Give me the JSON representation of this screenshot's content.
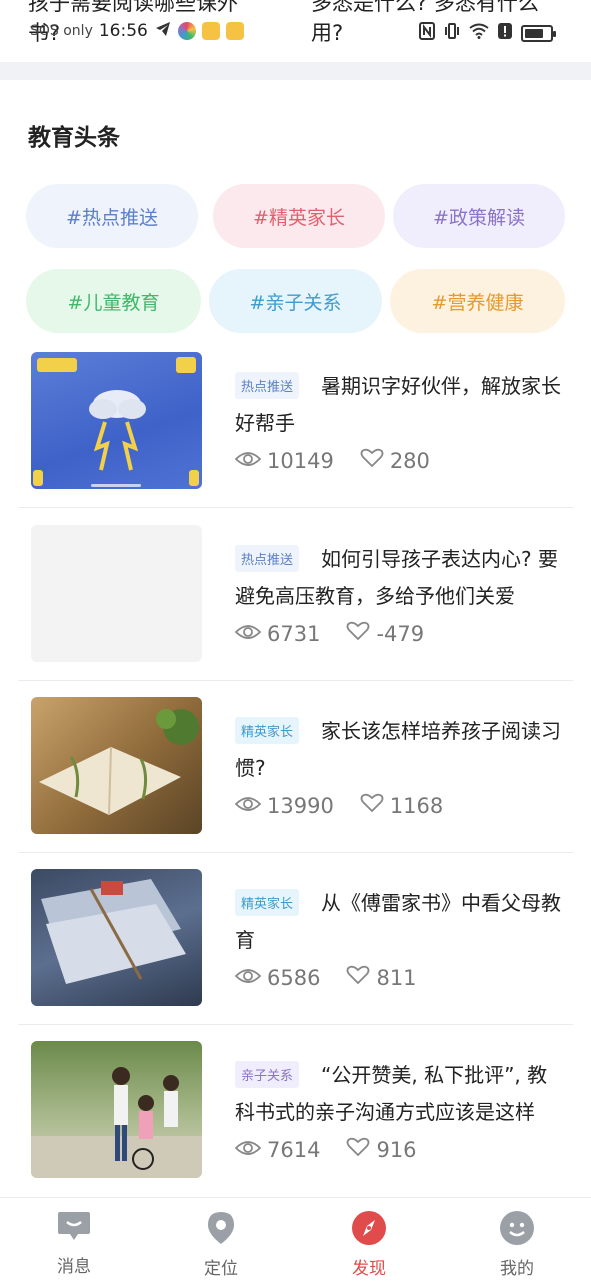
{
  "status_bar": {
    "carrier_text": "SOS only",
    "time": "16:56"
  },
  "cutoff": {
    "left_text": "孩子需要阅读哪些课外书?",
    "right_text": "多悉是什么? 多悉有什么用?"
  },
  "section": {
    "title": "教育头条"
  },
  "tags": [
    {
      "label": "#热点推送",
      "bg": "#eef3fc",
      "color": "#5b7fc8"
    },
    {
      "label": "#精英家长",
      "bg": "#fce9ee",
      "color": "#e06070"
    },
    {
      "label": "#政策解读",
      "bg": "#f0eefc",
      "color": "#8a73c9"
    },
    {
      "label": "#儿童教育",
      "bg": "#e6f8ea",
      "color": "#3fb86a"
    },
    {
      "label": "#亲子关系",
      "bg": "#e6f4fb",
      "color": "#3d9bcd"
    },
    {
      "label": "#营养健康",
      "bg": "#fdf2df",
      "color": "#e49a2c"
    }
  ],
  "articles": [
    {
      "badge": "热点推送",
      "badge_bg": "#eef3fc",
      "badge_color": "#5b7fc8",
      "title": "暑期识字好伙伴，解放家长好帮手",
      "views": "10149",
      "likes": "280"
    },
    {
      "badge": "热点推送",
      "badge_bg": "#eef3fc",
      "badge_color": "#5b7fc8",
      "title": "如何引导孩子表达内心? 要避免高压教育，多给予他们关爱",
      "views": "6731",
      "likes": "-479"
    },
    {
      "badge": "精英家长",
      "badge_bg": "#e6f4fb",
      "badge_color": "#3d9bcd",
      "title": "家长该怎样培养孩子阅读习惯?",
      "views": "13990",
      "likes": "1168"
    },
    {
      "badge": "精英家长",
      "badge_bg": "#e6f4fb",
      "badge_color": "#3d9bcd",
      "title": "从《傅雷家书》中看父母教育",
      "views": "6586",
      "likes": "811"
    },
    {
      "badge": "亲子关系",
      "badge_bg": "#f0eefc",
      "badge_color": "#8a73c9",
      "title": "“公开赞美, 私下批评”, 教科书式的亲子沟通方式应该是这样",
      "views": "7614",
      "likes": "916"
    }
  ],
  "nav": [
    {
      "label": "消息",
      "icon": "message-icon"
    },
    {
      "label": "定位",
      "icon": "location-icon"
    },
    {
      "label": "发现",
      "icon": "compass-icon"
    },
    {
      "label": "我的",
      "icon": "profile-icon"
    }
  ],
  "colors": {
    "accent": "#e04b4b",
    "nav_inactive": "#9aa0a6"
  }
}
